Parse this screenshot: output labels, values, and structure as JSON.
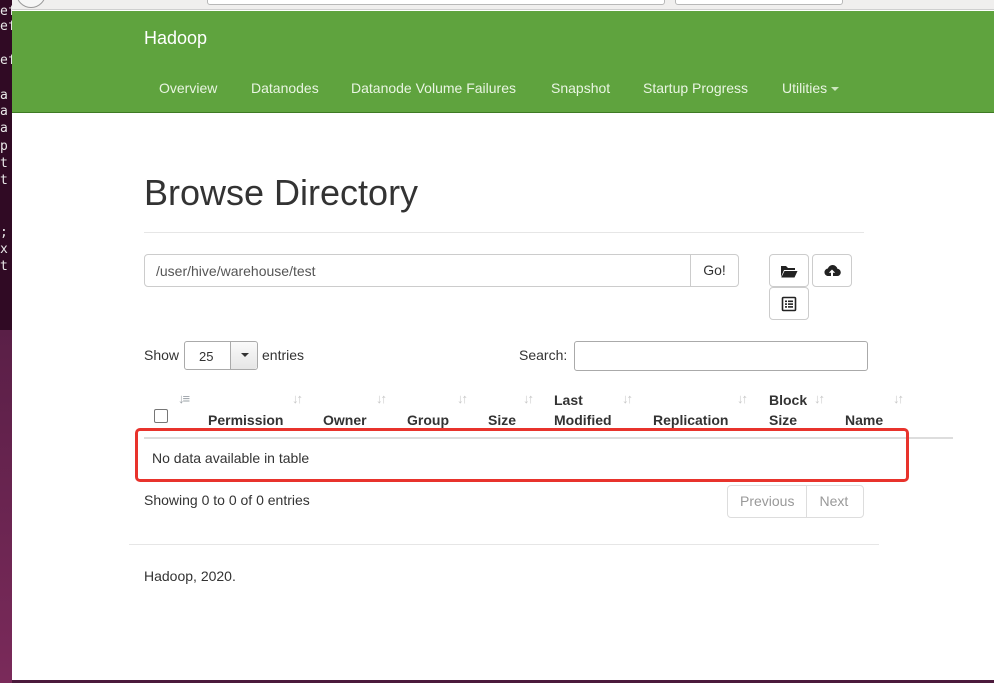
{
  "terminal": {
    "lines": [
      "ef",
      "ef",
      "",
      "ef",
      "",
      "a",
      "a",
      "a",
      "p",
      "t",
      "t",
      "",
      ";",
      ";",
      "x",
      "t",
      ""
    ]
  },
  "navbar": {
    "brand": "Hadoop",
    "items": [
      {
        "label": "Overview"
      },
      {
        "label": "Datanodes"
      },
      {
        "label": "Datanode Volume Failures"
      },
      {
        "label": "Snapshot"
      },
      {
        "label": "Startup Progress"
      },
      {
        "label": "Utilities"
      }
    ],
    "bg_color": "#5fa33e"
  },
  "main": {
    "title": "Browse Directory",
    "path_value": "/user/hive/warehouse/test",
    "go_label": "Go!",
    "icons": [
      "folder-open-icon",
      "cloud-upload-icon",
      "list-alt-icon"
    ]
  },
  "table": {
    "show_label": "Show",
    "entries_value": "25",
    "entries_label": "entries",
    "search_label": "Search:",
    "search_value": "",
    "columns": [
      {
        "label": "Permission"
      },
      {
        "label": "Owner"
      },
      {
        "label": "Group"
      },
      {
        "label": "Size"
      },
      {
        "label_line1": "Last",
        "label_line2": "Modified"
      },
      {
        "label": "Replication"
      },
      {
        "label_line1": "Block",
        "label_line2": "Size"
      },
      {
        "label": "Name"
      }
    ],
    "empty_message": "No data available in table",
    "info": "Showing 0 to 0 of 0 entries",
    "prev_label": "Previous",
    "next_label": "Next",
    "highlight_color": "#e8332c"
  },
  "footer": {
    "text": "Hadoop, 2020."
  }
}
